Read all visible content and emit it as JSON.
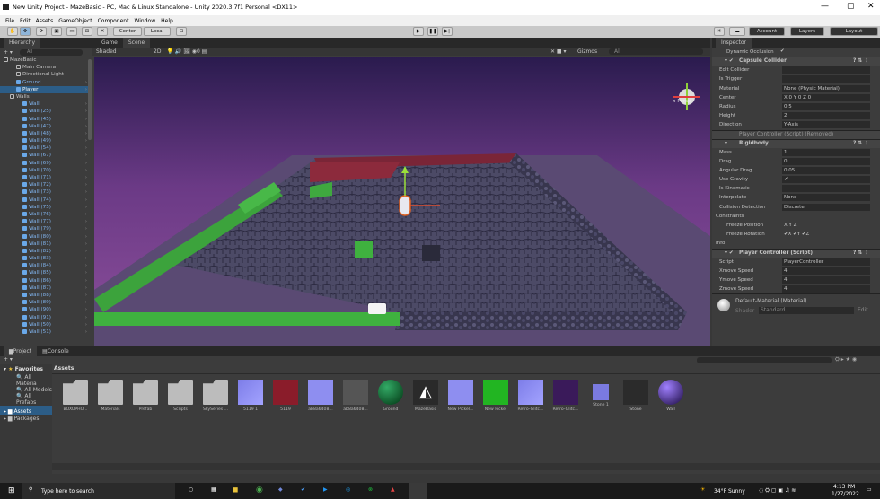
{
  "window": {
    "title": "New Unity Project - MazeBasic - PC, Mac & Linux Standalone - Unity 2020.3.7f1 Personal <DX11>",
    "controls": [
      "—",
      "▢",
      "✕"
    ]
  },
  "menu": [
    "File",
    "Edit",
    "Assets",
    "GameObject",
    "Component",
    "Window",
    "Help"
  ],
  "toolbar": {
    "center": "Center",
    "local": "Local",
    "account": "Account",
    "layers": "Layers",
    "layout": "Layout"
  },
  "hierarchy": {
    "tab": "Hierarchy",
    "search": "All",
    "items": [
      {
        "label": "MazeBasic",
        "indent": 0,
        "type": "scene"
      },
      {
        "label": "Main Camera",
        "indent": 2,
        "type": "obj"
      },
      {
        "label": "Directional Light",
        "indent": 2,
        "type": "obj"
      },
      {
        "label": "Ground",
        "indent": 2,
        "type": "prefab"
      },
      {
        "label": "Player",
        "indent": 2,
        "type": "prefab",
        "selected": true
      },
      {
        "label": "Walls",
        "indent": 1,
        "type": "obj"
      },
      {
        "label": "Wall",
        "indent": 3,
        "type": "prefab"
      },
      {
        "label": "Wall (25)",
        "indent": 3,
        "type": "prefab"
      },
      {
        "label": "Wall (45)",
        "indent": 3,
        "type": "prefab"
      },
      {
        "label": "Wall (47)",
        "indent": 3,
        "type": "prefab"
      },
      {
        "label": "Wall (48)",
        "indent": 3,
        "type": "prefab"
      },
      {
        "label": "Wall (49)",
        "indent": 3,
        "type": "prefab"
      },
      {
        "label": "Wall (54)",
        "indent": 3,
        "type": "prefab"
      },
      {
        "label": "Wall (67)",
        "indent": 3,
        "type": "prefab"
      },
      {
        "label": "Wall (69)",
        "indent": 3,
        "type": "prefab"
      },
      {
        "label": "Wall (70)",
        "indent": 3,
        "type": "prefab"
      },
      {
        "label": "Wall (71)",
        "indent": 3,
        "type": "prefab"
      },
      {
        "label": "Wall (72)",
        "indent": 3,
        "type": "prefab"
      },
      {
        "label": "Wall (73)",
        "indent": 3,
        "type": "prefab"
      },
      {
        "label": "Wall (74)",
        "indent": 3,
        "type": "prefab"
      },
      {
        "label": "Wall (75)",
        "indent": 3,
        "type": "prefab"
      },
      {
        "label": "Wall (76)",
        "indent": 3,
        "type": "prefab"
      },
      {
        "label": "Wall (77)",
        "indent": 3,
        "type": "prefab"
      },
      {
        "label": "Wall (79)",
        "indent": 3,
        "type": "prefab"
      },
      {
        "label": "Wall (80)",
        "indent": 3,
        "type": "prefab"
      },
      {
        "label": "Wall (81)",
        "indent": 3,
        "type": "prefab"
      },
      {
        "label": "Wall (82)",
        "indent": 3,
        "type": "prefab"
      },
      {
        "label": "Wall (83)",
        "indent": 3,
        "type": "prefab"
      },
      {
        "label": "Wall (84)",
        "indent": 3,
        "type": "prefab"
      },
      {
        "label": "Wall (85)",
        "indent": 3,
        "type": "prefab"
      },
      {
        "label": "Wall (86)",
        "indent": 3,
        "type": "prefab"
      },
      {
        "label": "Wall (87)",
        "indent": 3,
        "type": "prefab"
      },
      {
        "label": "Wall (88)",
        "indent": 3,
        "type": "prefab"
      },
      {
        "label": "Wall (89)",
        "indent": 3,
        "type": "prefab"
      },
      {
        "label": "Wall (90)",
        "indent": 3,
        "type": "prefab"
      },
      {
        "label": "Wall (91)",
        "indent": 3,
        "type": "prefab"
      },
      {
        "label": "Wall (50)",
        "indent": 3,
        "type": "prefab"
      },
      {
        "label": "Wall (51)",
        "indent": 3,
        "type": "prefab"
      }
    ]
  },
  "scene": {
    "tabs": [
      "Game",
      "Scene"
    ],
    "shading": "Shaded",
    "mode": "2D",
    "gizmos": "Gizmos",
    "search": "All",
    "persp": "< Persp"
  },
  "inspector": {
    "tab": "Inspector",
    "dynamic_occlusion": "Dynamic Occlusion",
    "capsule": {
      "title": "Capsule Collider",
      "rows": [
        {
          "label": "Edit Collider",
          "value": ""
        },
        {
          "label": "Is Trigger",
          "value": ""
        },
        {
          "label": "Material",
          "value": "None (Physic Material)"
        },
        {
          "label": "Center",
          "value": "X 0        Y 0        Z 0"
        },
        {
          "label": "Radius",
          "value": "0.5"
        },
        {
          "label": "Height",
          "value": "2"
        },
        {
          "label": "Direction",
          "value": "Y-Axis"
        }
      ]
    },
    "removed": "Player Controller (Script) (Removed)",
    "rigidbody": {
      "title": "Rigidbody",
      "rows": [
        {
          "label": "Mass",
          "value": "1"
        },
        {
          "label": "Drag",
          "value": "0"
        },
        {
          "label": "Angular Drag",
          "value": "0.05"
        },
        {
          "label": "Use Gravity",
          "value": "✔"
        },
        {
          "label": "Is Kinematic",
          "value": ""
        },
        {
          "label": "Interpolate",
          "value": "None"
        },
        {
          "label": "Collision Detection",
          "value": "Discrete"
        }
      ],
      "constraints": "Constraints",
      "freeze_pos": "Freeze Position",
      "freeze_pos_val": "X  Y  Z",
      "freeze_rot": "Freeze Rotation",
      "freeze_rot_val": "✔X ✔Y ✔Z",
      "info": "Info"
    },
    "player": {
      "title": "Player Controller (Script)",
      "rows": [
        {
          "label": "Script",
          "value": "PlayerController"
        },
        {
          "label": "Xmove Speed",
          "value": "4"
        },
        {
          "label": "Ymove Speed",
          "value": "4"
        },
        {
          "label": "Zmove Speed",
          "value": "4"
        }
      ]
    },
    "material": "Default-Material (Material)",
    "shader_label": "Shader",
    "shader": "Standard",
    "edit": "Edit..."
  },
  "project": {
    "tabs": [
      "Project",
      "Console"
    ],
    "favorites": "Favorites",
    "fav_items": [
      "All Materia",
      "All Models",
      "All Prefabs"
    ],
    "assets": "Assets",
    "packages": "Packages",
    "header": "Assets",
    "items": [
      {
        "name": "BOXOPHO...",
        "kind": "folder"
      },
      {
        "name": "Materials",
        "kind": "folder"
      },
      {
        "name": "Prefab",
        "kind": "folder"
      },
      {
        "name": "Scripts",
        "kind": "folder"
      },
      {
        "name": "SkySeries ...",
        "kind": "folder"
      },
      {
        "name": "5119 1",
        "kind": "blue"
      },
      {
        "name": "5119",
        "kind": "red"
      },
      {
        "name": "ab8a6408...",
        "kind": "lav"
      },
      {
        "name": "ab8a6408...",
        "kind": "grey"
      },
      {
        "name": "Ground",
        "kind": "greensphere"
      },
      {
        "name": "MazeBasic",
        "kind": "unity"
      },
      {
        "name": "New Pickel...",
        "kind": "lav"
      },
      {
        "name": "New Pickel",
        "kind": "green"
      },
      {
        "name": "Retro-Glitc...",
        "kind": "blue"
      },
      {
        "name": "Retro-Glitc...",
        "kind": "glitch"
      },
      {
        "name": "Stone 1",
        "kind": "smallblue"
      },
      {
        "name": "Stone",
        "kind": "stone"
      },
      {
        "name": "Wall",
        "kind": "purplesphere"
      }
    ]
  },
  "taskbar": {
    "search": "Type here to search",
    "weather": "34°F  Sunny",
    "time": "4:13 PM",
    "date": "1/27/2022"
  }
}
